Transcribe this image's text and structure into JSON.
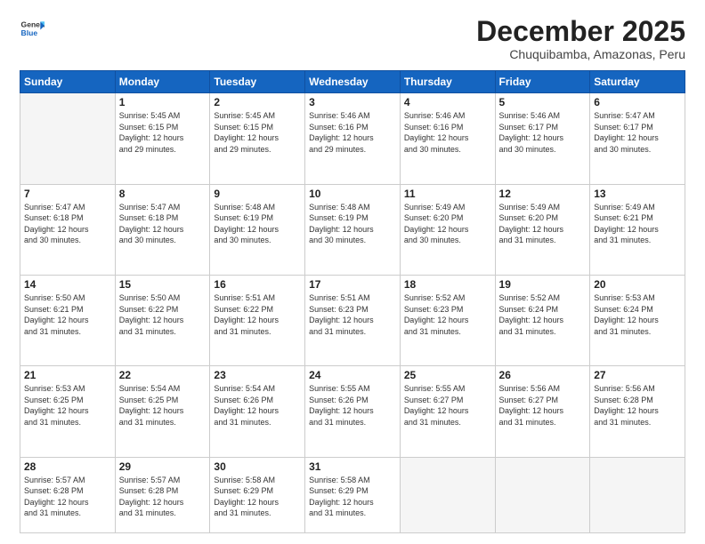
{
  "header": {
    "logo_general": "General",
    "logo_blue": "Blue",
    "month": "December 2025",
    "location": "Chuquibamba, Amazonas, Peru"
  },
  "days_of_week": [
    "Sunday",
    "Monday",
    "Tuesday",
    "Wednesday",
    "Thursday",
    "Friday",
    "Saturday"
  ],
  "weeks": [
    [
      {
        "day": "",
        "info": ""
      },
      {
        "day": "1",
        "info": "Sunrise: 5:45 AM\nSunset: 6:15 PM\nDaylight: 12 hours\nand 29 minutes."
      },
      {
        "day": "2",
        "info": "Sunrise: 5:45 AM\nSunset: 6:15 PM\nDaylight: 12 hours\nand 29 minutes."
      },
      {
        "day": "3",
        "info": "Sunrise: 5:46 AM\nSunset: 6:16 PM\nDaylight: 12 hours\nand 29 minutes."
      },
      {
        "day": "4",
        "info": "Sunrise: 5:46 AM\nSunset: 6:16 PM\nDaylight: 12 hours\nand 30 minutes."
      },
      {
        "day": "5",
        "info": "Sunrise: 5:46 AM\nSunset: 6:17 PM\nDaylight: 12 hours\nand 30 minutes."
      },
      {
        "day": "6",
        "info": "Sunrise: 5:47 AM\nSunset: 6:17 PM\nDaylight: 12 hours\nand 30 minutes."
      }
    ],
    [
      {
        "day": "7",
        "info": "Sunrise: 5:47 AM\nSunset: 6:18 PM\nDaylight: 12 hours\nand 30 minutes."
      },
      {
        "day": "8",
        "info": "Sunrise: 5:47 AM\nSunset: 6:18 PM\nDaylight: 12 hours\nand 30 minutes."
      },
      {
        "day": "9",
        "info": "Sunrise: 5:48 AM\nSunset: 6:19 PM\nDaylight: 12 hours\nand 30 minutes."
      },
      {
        "day": "10",
        "info": "Sunrise: 5:48 AM\nSunset: 6:19 PM\nDaylight: 12 hours\nand 30 minutes."
      },
      {
        "day": "11",
        "info": "Sunrise: 5:49 AM\nSunset: 6:20 PM\nDaylight: 12 hours\nand 30 minutes."
      },
      {
        "day": "12",
        "info": "Sunrise: 5:49 AM\nSunset: 6:20 PM\nDaylight: 12 hours\nand 31 minutes."
      },
      {
        "day": "13",
        "info": "Sunrise: 5:49 AM\nSunset: 6:21 PM\nDaylight: 12 hours\nand 31 minutes."
      }
    ],
    [
      {
        "day": "14",
        "info": "Sunrise: 5:50 AM\nSunset: 6:21 PM\nDaylight: 12 hours\nand 31 minutes."
      },
      {
        "day": "15",
        "info": "Sunrise: 5:50 AM\nSunset: 6:22 PM\nDaylight: 12 hours\nand 31 minutes."
      },
      {
        "day": "16",
        "info": "Sunrise: 5:51 AM\nSunset: 6:22 PM\nDaylight: 12 hours\nand 31 minutes."
      },
      {
        "day": "17",
        "info": "Sunrise: 5:51 AM\nSunset: 6:23 PM\nDaylight: 12 hours\nand 31 minutes."
      },
      {
        "day": "18",
        "info": "Sunrise: 5:52 AM\nSunset: 6:23 PM\nDaylight: 12 hours\nand 31 minutes."
      },
      {
        "day": "19",
        "info": "Sunrise: 5:52 AM\nSunset: 6:24 PM\nDaylight: 12 hours\nand 31 minutes."
      },
      {
        "day": "20",
        "info": "Sunrise: 5:53 AM\nSunset: 6:24 PM\nDaylight: 12 hours\nand 31 minutes."
      }
    ],
    [
      {
        "day": "21",
        "info": "Sunrise: 5:53 AM\nSunset: 6:25 PM\nDaylight: 12 hours\nand 31 minutes."
      },
      {
        "day": "22",
        "info": "Sunrise: 5:54 AM\nSunset: 6:25 PM\nDaylight: 12 hours\nand 31 minutes."
      },
      {
        "day": "23",
        "info": "Sunrise: 5:54 AM\nSunset: 6:26 PM\nDaylight: 12 hours\nand 31 minutes."
      },
      {
        "day": "24",
        "info": "Sunrise: 5:55 AM\nSunset: 6:26 PM\nDaylight: 12 hours\nand 31 minutes."
      },
      {
        "day": "25",
        "info": "Sunrise: 5:55 AM\nSunset: 6:27 PM\nDaylight: 12 hours\nand 31 minutes."
      },
      {
        "day": "26",
        "info": "Sunrise: 5:56 AM\nSunset: 6:27 PM\nDaylight: 12 hours\nand 31 minutes."
      },
      {
        "day": "27",
        "info": "Sunrise: 5:56 AM\nSunset: 6:28 PM\nDaylight: 12 hours\nand 31 minutes."
      }
    ],
    [
      {
        "day": "28",
        "info": "Sunrise: 5:57 AM\nSunset: 6:28 PM\nDaylight: 12 hours\nand 31 minutes."
      },
      {
        "day": "29",
        "info": "Sunrise: 5:57 AM\nSunset: 6:28 PM\nDaylight: 12 hours\nand 31 minutes."
      },
      {
        "day": "30",
        "info": "Sunrise: 5:58 AM\nSunset: 6:29 PM\nDaylight: 12 hours\nand 31 minutes."
      },
      {
        "day": "31",
        "info": "Sunrise: 5:58 AM\nSunset: 6:29 PM\nDaylight: 12 hours\nand 31 minutes."
      },
      {
        "day": "",
        "info": ""
      },
      {
        "day": "",
        "info": ""
      },
      {
        "day": "",
        "info": ""
      }
    ]
  ]
}
